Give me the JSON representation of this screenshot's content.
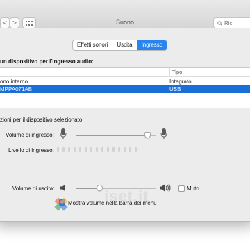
{
  "window": {
    "title": "Suono"
  },
  "toolbar": {
    "back_glyph": "<",
    "forward_glyph": ">",
    "grid_glyph": "⋮⋮⋮"
  },
  "search": {
    "placeholder": "Ric"
  },
  "tabs": [
    {
      "label": "Effetti sonori",
      "active": false
    },
    {
      "label": "Uscita",
      "active": false
    },
    {
      "label": "Ingresso",
      "active": true
    }
  ],
  "device_section": {
    "heading": "un dispositivo per l'ingresso audio:",
    "columns": [
      "",
      "Tipo"
    ],
    "rows": [
      {
        "name": "ono interno",
        "type": "Integrato",
        "selected": false
      },
      {
        "name": "MPPA071AB",
        "type": "USB",
        "selected": true
      }
    ]
  },
  "settings_section": {
    "heading": "zioni per il dispositivo selezionato:",
    "input_volume_label": "Volume di ingresso:",
    "input_volume": 0.9,
    "input_level_label": "Livello di ingresso:",
    "input_level_segments": 15,
    "input_level_active": 0
  },
  "output": {
    "volume_label": "Volume di uscita:",
    "volume": 0.3,
    "mute_label": "Muto",
    "mute_checked": false,
    "show_in_menu_label": "Mostra volume nella barra dei menu",
    "show_in_menu_checked": true
  },
  "watermark": {
    "text": "iset.it"
  },
  "colors": {
    "accent": "#2a84f0",
    "selection": "#1a6ed8",
    "window_bg": "#ececec"
  }
}
